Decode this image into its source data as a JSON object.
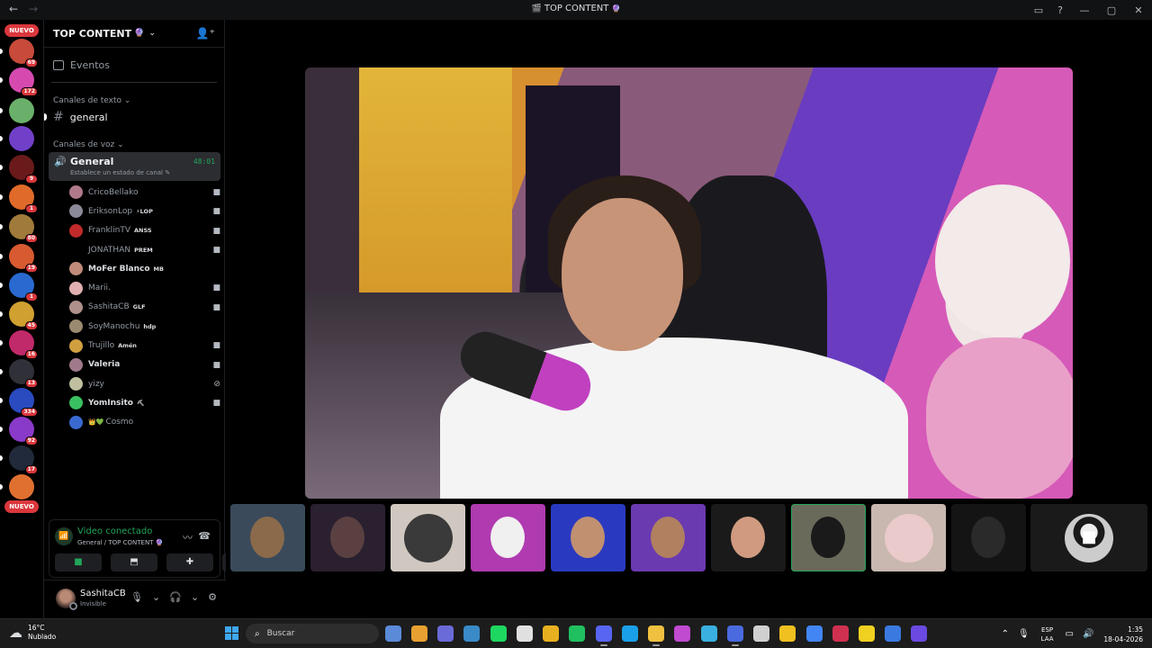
{
  "window": {
    "title": "TOP CONTENT",
    "title_icon": "server-emoji-icon",
    "title_suffix_icon": "crystal-emoji-icon"
  },
  "servers": {
    "nuevo_label": "NUEVO",
    "items": [
      {
        "icon": "server-avatar",
        "color": "#c84a3a",
        "count": "69"
      },
      {
        "icon": "server-avatar",
        "color": "#d64ab0",
        "count": "172"
      },
      {
        "icon": "server-avatar",
        "color": "#6ab06a",
        "count": ""
      },
      {
        "icon": "server-avatar",
        "color": "#7040c8",
        "count": ""
      },
      {
        "icon": "server-avatar",
        "color": "#6a1a1a",
        "count": "9"
      },
      {
        "icon": "server-avatar",
        "color": "#e06a2a",
        "count": "1"
      },
      {
        "icon": "server-avatar",
        "color": "#a07a3a",
        "count": "80"
      },
      {
        "icon": "server-avatar",
        "color": "#d85a30",
        "count": "19"
      },
      {
        "icon": "server-avatar",
        "color": "#2a6ad0",
        "count": "1"
      },
      {
        "icon": "server-avatar",
        "color": "#d0a030",
        "count": "45"
      },
      {
        "icon": "server-avatar",
        "color": "#c02a6a",
        "count": "16"
      },
      {
        "icon": "server-avatar",
        "color": "#303038",
        "count": "13"
      },
      {
        "icon": "server-avatar",
        "color": "#2a4ac0",
        "count": "334"
      },
      {
        "icon": "server-avatar",
        "color": "#8a3ac8",
        "count": "92"
      },
      {
        "icon": "server-avatar",
        "color": "#202a3a",
        "count": "17"
      },
      {
        "icon": "server-avatar",
        "color": "#e07030",
        "count": ""
      }
    ]
  },
  "sidebar": {
    "server_name": "TOP CONTENT",
    "events_label": "Eventos",
    "text_category": "Canales de texto",
    "text_channel": "general",
    "voice_category": "Canales de voz",
    "voice_channel": {
      "name": "General",
      "timer": "48:01",
      "status": "Establece un estado de canal"
    },
    "members": [
      {
        "name": "CricoBellako",
        "bold": false,
        "tag": "",
        "camera": true,
        "color": "#b07a8a"
      },
      {
        "name": "EriksonLop",
        "bold": false,
        "tag": "⚡LOP",
        "camera": true,
        "color": "#8a8a9a"
      },
      {
        "name": "FranklinTV",
        "bold": false,
        "tag": "ANSS",
        "camera": true,
        "color": "#c02a2a"
      },
      {
        "name": "JONATHAN",
        "bold": false,
        "tag": "PREM",
        "camera": true,
        "color": "#000000"
      },
      {
        "name": "MoFer Blanco",
        "bold": true,
        "tag": "MB",
        "camera": false,
        "color": "#c08a7a"
      },
      {
        "name": "Marii.",
        "bold": false,
        "tag": "",
        "camera": true,
        "color": "#e0b0b0"
      },
      {
        "name": "SashitaCB",
        "bold": false,
        "tag": "GLF",
        "camera": true,
        "color": "#b0908a"
      },
      {
        "name": "SoyManochu",
        "bold": false,
        "tag": "hdp",
        "camera": false,
        "color": "#9a8a70"
      },
      {
        "name": "Trujillo",
        "bold": false,
        "tag": "Amén",
        "camera": true,
        "color": "#d0a040"
      },
      {
        "name": "Valeria",
        "bold": true,
        "tag": "",
        "camera": true,
        "color": "#a07a8a"
      },
      {
        "name": "yizy",
        "bold": false,
        "tag": "",
        "camera": false,
        "muted_camera": true,
        "color": "#c0c0a0"
      },
      {
        "name": "YomInsito",
        "bold": true,
        "tag": "⛏",
        "camera": true,
        "color": "#3ac060"
      },
      {
        "name": "Cosmo",
        "bold": false,
        "tag": "",
        "camera": false,
        "color": "#3a6ad0",
        "decor": "🤴💚"
      }
    ]
  },
  "voice_panel": {
    "title": "Video conectado",
    "subtitle": "General / TOP CONTENT",
    "buttons": [
      "camera-button",
      "screen-share-button",
      "activities-button",
      "soundboard-button"
    ]
  },
  "user": {
    "name": "SashitaCB",
    "status": "Invisible"
  },
  "thumbnails": [
    {
      "bg": "#3a4a5a",
      "face": "#8a6a4a"
    },
    {
      "bg": "#2a2030",
      "face": "#5a4040"
    },
    {
      "bg": "#d0c8c0",
      "face": "#3a3a3a"
    },
    {
      "bg": "#b03ab0",
      "face": "#f0f0f0"
    },
    {
      "bg": "#2a3ac0",
      "face": "#c09070"
    },
    {
      "bg": "#6a3ab0",
      "face": "#b08060"
    },
    {
      "bg": "#1a1a1a",
      "face": "#d09a80"
    },
    {
      "bg": "#6a6a5a",
      "face": "#1a1a1a"
    },
    {
      "bg": "#c8b8b0",
      "face": "#eacaca"
    },
    {
      "bg": "#141414",
      "face": "#2a2a2a"
    }
  ],
  "taskbar": {
    "weather_temp": "16°C",
    "weather_desc": "Nublado",
    "search_placeholder": "Buscar",
    "lang_top": "ESP",
    "lang_bottom": "LAA",
    "time": "1:35",
    "date": "18-04-2026",
    "apps": [
      "#5a8ad8",
      "#e8a030",
      "#6a6ad8",
      "#3a8ac8",
      "#1ed760",
      "#e0e0e0",
      "#e8b020",
      "#20c060",
      "#5865f2",
      "#1aa0e8",
      "#f0c040",
      "#c04ad0",
      "#3ab0e0",
      "#4a6ae0",
      "#d0d0d0",
      "#f0c020",
      "#4285f4",
      "#d03050",
      "#f0d020",
      "#3a7ae0",
      "#6a4ae0"
    ]
  }
}
